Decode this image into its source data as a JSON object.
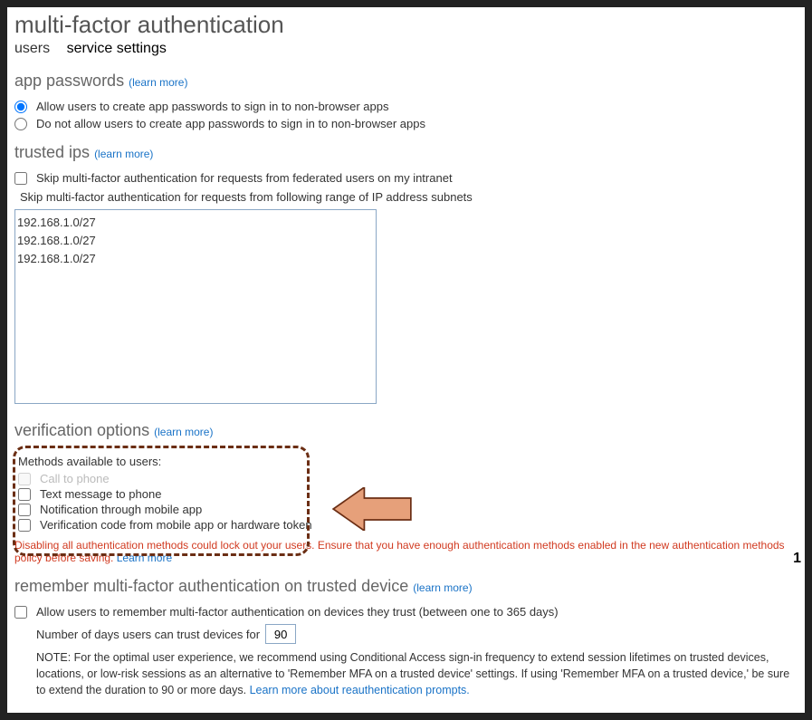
{
  "title": "multi-factor authentication",
  "tabs": {
    "users": "users",
    "service_settings": "service settings"
  },
  "app_passwords": {
    "heading": "app passwords",
    "learn": "(learn more)",
    "allow": "Allow users to create app passwords to sign in to non-browser apps",
    "deny": "Do not allow users to create app passwords to sign in to non-browser apps"
  },
  "trusted_ips": {
    "heading": "trusted ips",
    "learn": "(learn more)",
    "skip_federated": "Skip multi-factor authentication for requests from federated users on my intranet",
    "skip_ranges": "Skip multi-factor authentication for requests from following range of IP address subnets",
    "ip_text": "192.168.1.0/27\n192.168.1.0/27\n192.168.1.0/27"
  },
  "verification": {
    "heading": "verification options",
    "learn": "(learn more)",
    "methods_title": "Methods available to users:",
    "call": "Call to phone",
    "sms": "Text message to phone",
    "app_notify": "Notification through mobile app",
    "app_code": "Verification code from mobile app or hardware token",
    "warning": "Disabling all authentication methods could lock out your users. Ensure that you have enough authentication methods enabled in the new authentication methods policy before saving.",
    "warning_link": "Learn more"
  },
  "remember": {
    "heading": "remember multi-factor authentication on trusted device",
    "learn": "(learn more)",
    "allow": "Allow users to remember multi-factor authentication on devices they trust (between one to 365 days)",
    "days_label": "Number of days users can trust devices for",
    "days_value": "90",
    "note_prefix": "NOTE: For the optimal user experience, we recommend using Conditional Access sign-in frequency to extend session lifetimes on trusted devices, locations, or low-risk sessions as an alternative to 'Remember MFA on a trusted device' settings. If using 'Remember MFA on a trusted device,' be sure to extend the duration to 90 or more days. ",
    "note_link": "Learn more about reauthentication prompts."
  },
  "stray_mark": "1"
}
